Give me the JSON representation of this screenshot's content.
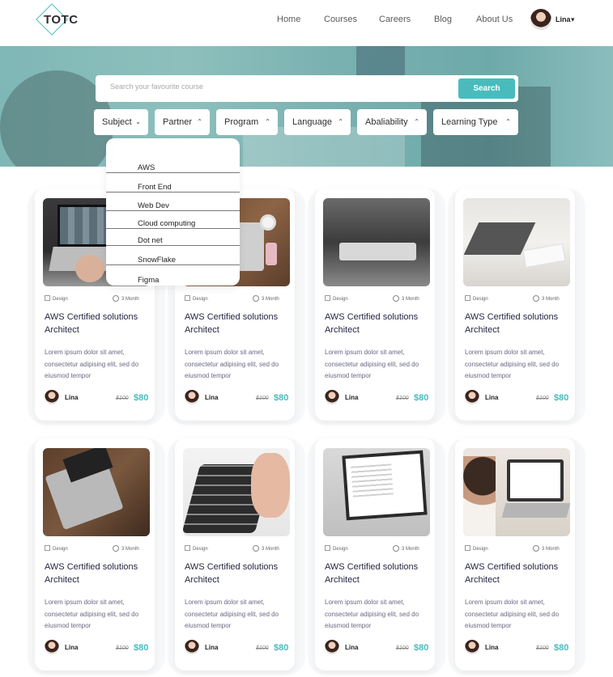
{
  "header": {
    "logo_text": "TOTC",
    "nav": [
      "Home",
      "Courses",
      "Careers",
      "Blog",
      "About Us"
    ],
    "user_name": "Lina"
  },
  "search": {
    "placeholder": "Search your favourite course",
    "button_label": "Search"
  },
  "filters": [
    {
      "label": "Subject",
      "chevron": "down"
    },
    {
      "label": "Partner",
      "chevron": "up"
    },
    {
      "label": "Program",
      "chevron": "up"
    },
    {
      "label": "Language",
      "chevron": "up"
    },
    {
      "label": "Abaliability",
      "chevron": "up"
    },
    {
      "label": "Learning Type",
      "chevron": "up"
    }
  ],
  "dropdown": {
    "items": [
      "AWS",
      "Front End",
      "Web Dev",
      "Cloud computing",
      "Dot net",
      "SnowFlake",
      "Figma"
    ]
  },
  "courses": [
    {
      "tag": "Design",
      "duration": "3 Month",
      "title": "AWS Certified solutions Architect",
      "desc": "Lorem ipsum dolor sit amet, consectetur adipising elit, sed do eiusmod tempor",
      "author": "Lina",
      "old_price": "$100",
      "price": "$80"
    },
    {
      "tag": "Design",
      "duration": "3 Month",
      "title": "AWS Certified solutions Architect",
      "desc": "Lorem ipsum dolor sit amet, consectetur adipising elit, sed do eiusmod tempor",
      "author": "Lina",
      "old_price": "$100",
      "price": "$80"
    },
    {
      "tag": "Design",
      "duration": "3 Month",
      "title": "AWS Certified solutions Architect",
      "desc": "Lorem ipsum dolor sit amet, consectetur adipising elit, sed do eiusmod tempor",
      "author": "Lina",
      "old_price": "$100",
      "price": "$80"
    },
    {
      "tag": "Design",
      "duration": "3 Month",
      "title": "AWS Certified solutions Architect",
      "desc": "Lorem ipsum dolor sit amet, consectetur adipising elit, sed do eiusmod tempor",
      "author": "Lina",
      "old_price": "$100",
      "price": "$80"
    },
    {
      "tag": "Design",
      "duration": "3 Month",
      "title": "AWS Certified solutions Architect",
      "desc": "Lorem ipsum dolor sit amet, consectetur adipising elit, sed do eiusmod tempor",
      "author": "Lina",
      "old_price": "$100",
      "price": "$80"
    },
    {
      "tag": "Design",
      "duration": "3 Month",
      "title": "AWS Certified solutions Architect",
      "desc": "Lorem ipsum dolor sit amet, consectetur adipising elit, sed do eiusmod tempor",
      "author": "Lina",
      "old_price": "$100",
      "price": "$80"
    },
    {
      "tag": "Design",
      "duration": "3 Month",
      "title": "AWS Certified solutions Architect",
      "desc": "Lorem ipsum dolor sit amet, consectetur adipising elit, sed do eiusmod tempor",
      "author": "Lina",
      "old_price": "$100",
      "price": "$80"
    },
    {
      "tag": "Design",
      "duration": "3 Month",
      "title": "AWS Certified solutions Architect",
      "desc": "Lorem ipsum dolor sit amet, consectetur adipising elit, sed do eiusmod tempor",
      "author": "Lina",
      "old_price": "$100",
      "price": "$80"
    }
  ],
  "colors": {
    "accent": "#49BBBD",
    "title": "#252641",
    "body": "#696984"
  },
  "icons": {
    "tag": "grid-icon",
    "duration": "clock-icon",
    "user_menu": "chevron-down-icon"
  }
}
